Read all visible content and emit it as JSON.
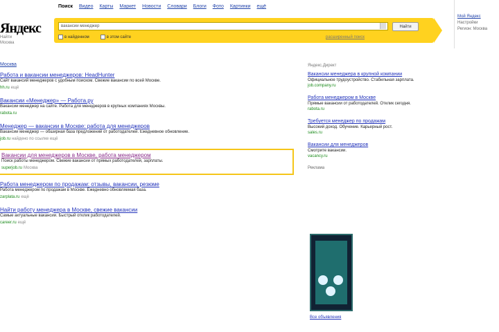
{
  "logo": {
    "text": "Яндекс",
    "sub1": "Найти",
    "sub2": "Москва"
  },
  "tabs": [
    "Поиск",
    "Видео",
    "Карты",
    "Маркет",
    "Новости",
    "Словари",
    "Блоги",
    "Фото",
    "Картинки",
    "ещё"
  ],
  "search": {
    "value": "вакансии менеджер",
    "button": "Найти",
    "opt1": "в найденном",
    "opt2": "в этом сайте",
    "advanced": "расширенный поиск"
  },
  "user": {
    "l1": "Мой Яндекс",
    "l2": "Настройки",
    "l3": "Регион: Москва"
  },
  "region_link": "Москва",
  "results": [
    {
      "title": "Работа и вакансии менеджеров: HeadHunter",
      "snippet": "Сайт вакансий менеджеров с удобным поиском. Свежие вакансии по всей Москве.",
      "url": "hh.ru",
      "meta": "ещё"
    },
    {
      "title": "Вакансии «Менеджер» — Работа.ру",
      "snippet": "Вакансии менеджер на сайте. Работа для менеджеров в крупных компаниях Москвы.",
      "url": "rabota.ru",
      "meta": ""
    },
    {
      "title": "Менеджер — вакансии в Москве: работа для менеджеров",
      "snippet": "Вакансии менеджер — обширная база предложений от работодателей. Ежедневное обновление.",
      "url": "job.ru",
      "meta": "найдено по ссылке  ещё"
    },
    {
      "title": "Вакансии для менеджеров в Москве, работа менеджером",
      "snippet": "Поиск работы менеджером. Свежие вакансии от прямых работодателей, зарплаты.",
      "url": "superjob.ru",
      "meta": "Москва"
    },
    {
      "title": "Работа менеджером по продажам: отзывы, вакансии, резюме",
      "snippet": "Работа менеджером по продажам в Москве. Ежедневно обновляемая база.",
      "url": "zarplata.ru",
      "meta": "ещё"
    },
    {
      "title": "Найти работу менеджера в Москве, свежие вакансии",
      "snippet": "Самые актуальные вакансии. Быстрый отклик работодателей.",
      "url": "career.ru",
      "meta": "ещё"
    }
  ],
  "ads": {
    "head": "Яндекс.Директ",
    "items": [
      {
        "title": "Вакансии менеджера в крупной компании",
        "text": "Официальное трудоустройство. Стабильная зарплата.",
        "url": "job.company.ru"
      },
      {
        "title": "Работа менеджером в Москве",
        "text": "Прямые вакансии от работодателей. Отклик сегодня.",
        "url": "rabota.ru"
      },
      {
        "title": "Требуется менеджер по продажам",
        "text": "Высокий доход. Обучение. Карьерный рост.",
        "url": "sales.ru"
      },
      {
        "title": "Вакансии для менеджеров",
        "text": "Смотрите вакансии.",
        "url": "vacancy.ru"
      }
    ],
    "banner_head": "Реклама",
    "all": "Все объявления"
  }
}
